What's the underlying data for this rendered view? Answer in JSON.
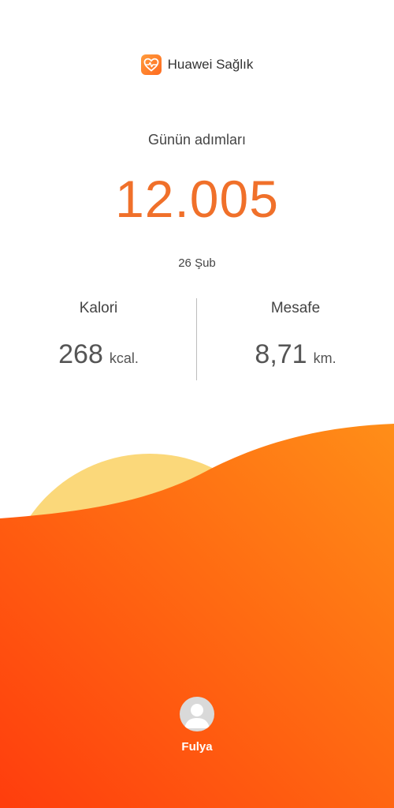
{
  "app": {
    "name": "Huawei Sağlık",
    "icon": "heart-pulse-icon",
    "accent_color": "#f0702a"
  },
  "steps": {
    "label": "Günün adımları",
    "value": "12.005",
    "date": "26 Şub"
  },
  "stats": {
    "calories": {
      "label": "Kalori",
      "value": "268",
      "unit": "kcal."
    },
    "distance": {
      "label": "Mesafe",
      "value": "8,71",
      "unit": "km."
    }
  },
  "user": {
    "name": "Fulya",
    "avatar_icon": "person-icon"
  },
  "colors": {
    "wave_orange_light": "#ff8a14",
    "wave_orange_dark": "#ff4a10",
    "sun_yellow": "#fbd87a"
  }
}
